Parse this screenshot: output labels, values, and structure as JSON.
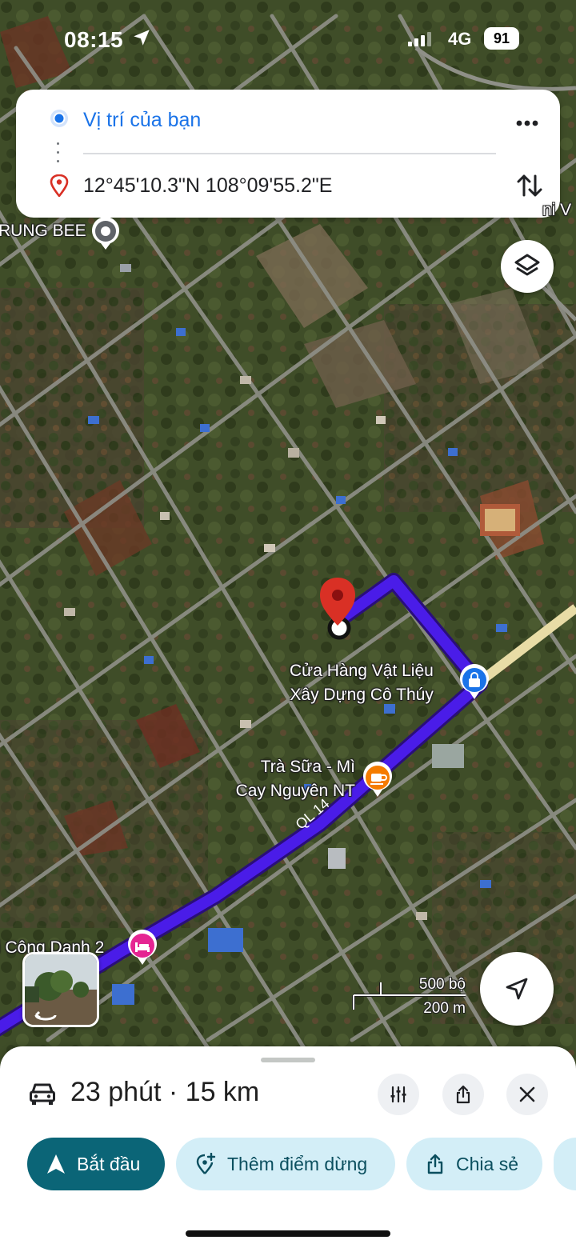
{
  "status_bar": {
    "time": "08:15",
    "network": "4G",
    "battery": "91"
  },
  "directions": {
    "origin": "Vị trí của bạn",
    "destination": "12°45'10.3\"N 108°09'55.2\"E"
  },
  "map": {
    "labels": {
      "rung_bee": "RUNG BEE",
      "cua_hang_line1": "Cửa Hàng Vật Liệu",
      "cua_hang_line2": "Xây Dựng Cô Thúy",
      "tra_sua_line1": "Trà Sữa - Mì",
      "tra_sua_line2": "Cay Nguyên NT",
      "road": "QL 14",
      "cong_danh": "i Công Danh 2",
      "top_right": "ni V"
    },
    "scale": {
      "imperial": "500 bộ",
      "metric": "200 m"
    },
    "route_color": "#4a1ce8",
    "pin_color": "#d93025"
  },
  "route_summary": {
    "text": "23 phút · 15 km"
  },
  "actions": {
    "start": "Bắt đầu",
    "add_stop": "Thêm điểm dừng",
    "share": "Chia sẻ"
  },
  "icons": [
    "location-arrow-icon",
    "signal-icon",
    "origin-dot-icon",
    "destination-pin-icon",
    "more-icon",
    "swap-icon",
    "layers-icon",
    "shopping-bag-icon",
    "coffee-icon",
    "hotel-icon",
    "poi-icon",
    "recenter-icon",
    "car-icon",
    "filter-icon",
    "share-icon",
    "close-icon",
    "navigation-icon",
    "add-stop-icon"
  ]
}
